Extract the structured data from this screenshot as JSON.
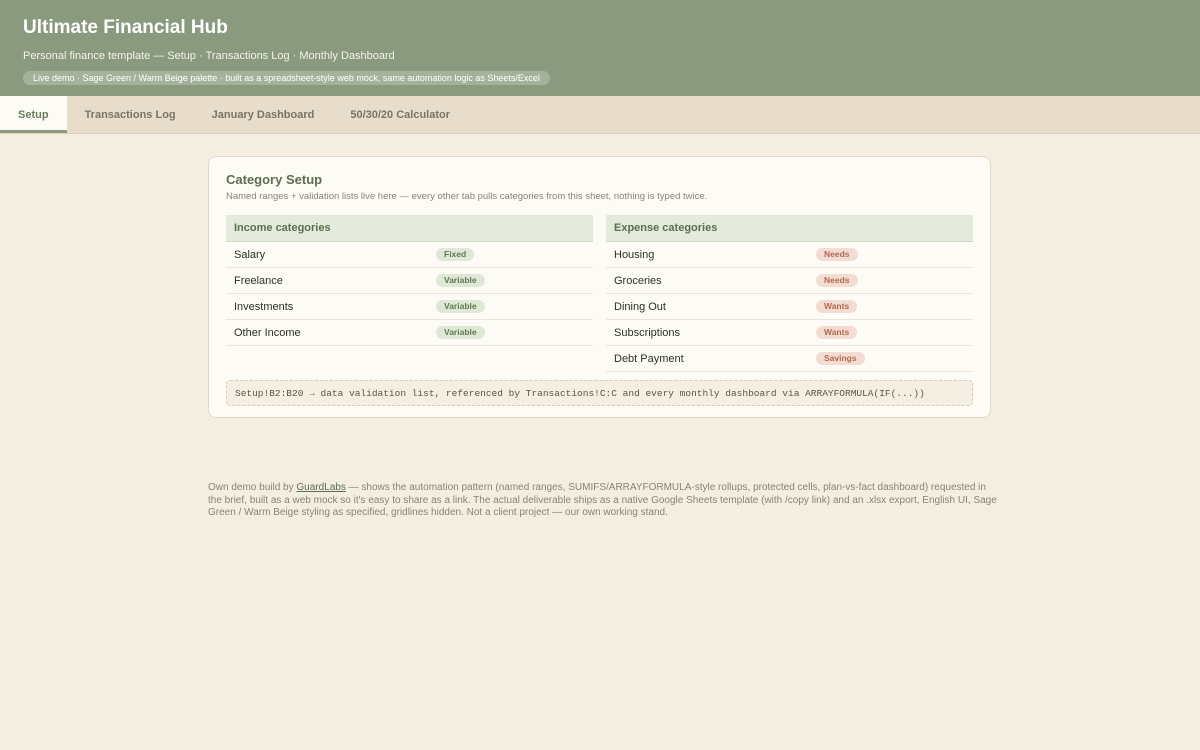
{
  "header": {
    "title": "Ultimate Financial Hub",
    "subtitle": "Personal finance template — Setup · Transactions Log · Monthly Dashboard",
    "badge": "Live demo · Sage Green / Warm Beige palette · built as a spreadsheet-style web mock, same automation logic as Sheets/Excel"
  },
  "tabs": [
    {
      "label": "Setup",
      "active": true
    },
    {
      "label": "Transactions Log",
      "active": false
    },
    {
      "label": "January Dashboard",
      "active": false
    },
    {
      "label": "50/30/20 Calculator",
      "active": false
    }
  ],
  "setup": {
    "title": "Category Setup",
    "subtitle": "Named ranges + validation lists live here — every other tab pulls categories from this sheet, nothing is typed twice.",
    "income": {
      "heading": "Income categories",
      "rows": [
        {
          "name": "Salary",
          "tag": "Fixed"
        },
        {
          "name": "Freelance",
          "tag": "Variable"
        },
        {
          "name": "Investments",
          "tag": "Variable"
        },
        {
          "name": "Other Income",
          "tag": "Variable"
        }
      ]
    },
    "expense": {
      "heading": "Expense categories",
      "rows": [
        {
          "name": "Housing",
          "tag": "Needs"
        },
        {
          "name": "Groceries",
          "tag": "Needs"
        },
        {
          "name": "Dining Out",
          "tag": "Wants"
        },
        {
          "name": "Subscriptions",
          "tag": "Wants"
        },
        {
          "name": "Debt Payment",
          "tag": "Savings"
        }
      ]
    },
    "formula": "Setup!B2:B20 → data validation list, referenced by Transactions!C:C and every monthly dashboard via ARRAYFORMULA(IF(...))"
  },
  "footer": {
    "prefix": "Own demo build by ",
    "link": "GuardLabs",
    "suffix": " — shows the automation pattern (named ranges, SUMIFS/ARRAYFORMULA-style rollups, protected cells, plan-vs-fact dashboard) requested in the brief, built as a web mock so it's easy to share as a link. The actual deliverable ships as a native Google Sheets template (with /copy link) and an .xlsx export, English UI, Sage Green / Warm Beige styling as specified, gridlines hidden. Not a client project — our own working stand."
  },
  "colors": {
    "sage": "#8a9a7f",
    "beige": "#f4ede2",
    "pill_green": "#dfe8d6",
    "pill_red": "#f3ddd3"
  }
}
